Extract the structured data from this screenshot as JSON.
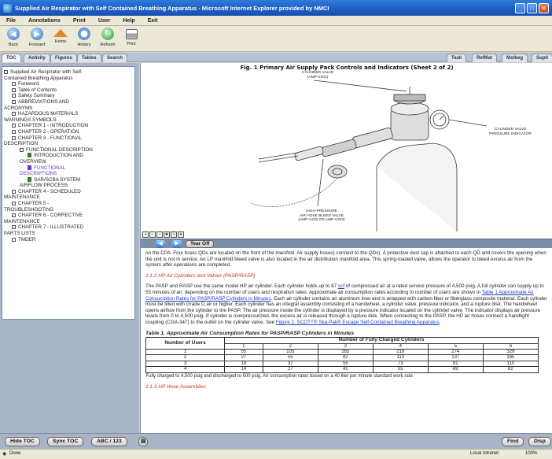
{
  "window": {
    "title": "Supplied Air Respirator with Self Contained Breathing Apparatus - Microsoft Internet Explorer provided by NMCI"
  },
  "menu": [
    "File",
    "Annotations",
    "Print",
    "User",
    "Help",
    "Exit"
  ],
  "toolbar": {
    "back": "Back",
    "forward": "Forward",
    "home": "Home",
    "history": "History",
    "refresh": "Refresh",
    "print": "Print"
  },
  "left_tabs": [
    "TOC",
    "Activity",
    "Figures",
    "Tables",
    "Search"
  ],
  "right_tabs": [
    "Task",
    "RefMat",
    "Mstbeg",
    "Supti"
  ],
  "toc": [
    "Supplied Air Respirator with Self-",
    "Contained Breathing Apparatus",
    "Foreword",
    "Table of Contents",
    "Safety Summary",
    "ABBREVIATIONS AND",
    "ACRONYMS",
    "HAZARDOUS MATERIALS",
    "WARNINGS SYMBOLS",
    "CHAPTER 1 - INTRODUCTION",
    "CHAPTER 2 - OPERATION",
    "CHAPTER 3 - FUNCTIONAL",
    "DESCRIPTION",
    "FUNCTIONAL DESCRIPTION",
    "INTRODUCTION AND",
    "OVERVIEW",
    "FUNCTIONAL",
    "DESCRIPTIONS",
    "SAR/SCBA SYSTEM",
    "AIRFLOW PROCESS",
    "CHAPTER 4 - SCHEDULED",
    "MAINTENANCE",
    "CHAPTER 5 -",
    "TROUBLESHOOTING",
    "CHAPTER 6 - CORRECTIVE",
    "MAINTENANCE",
    "CHAPTER 7 - ILLUSTRATED",
    "PARTS LISTS",
    "TMDER"
  ],
  "figure": {
    "title": "Fig. 1 Primary Air Supply Pack Controls and Indicators (Sheet 2 of 2)",
    "label_valve": "CYLINDER VALVE",
    "label_valve_ref": "(AMP-V201)",
    "label_gauge_1": "CYLINDER VALVE",
    "label_gauge_2": "PRESSURE INDICATOR",
    "label_bleed_1": "HIGH-PRESSURE",
    "label_bleed_2": "AIR HOSE BLEED VALVE",
    "label_bleed_3": "(AMP-V202 OR AMP-V203)"
  },
  "nav": {
    "tear_off": "Tear Off"
  },
  "text": {
    "para0": "on the CPA. Four brass QDs are located on the front of the manifold. Air supply hoses) connect to the QDs). A protective dust cap is attached to each QD and covers the opening when the unit is not in service. An LP manifold bleed valve is also located in the air distribution manifold area. This spring-loaded valve, allows the operator to bleed excess air from the system after operations are completed.",
    "heading1": "1.1.2 HP Air Cylinders and Valves (PASP/RASP)",
    "para1a": "The PASP and RASP use the same model HP air cylinder. Each cylinder holds up to 87 ",
    "scf": "scf",
    "para1b": " of compressed air at a rated service pressure of 4,500 psig. A full cylinder can supply up to 55 minutes of air, depending on the number of users and respiration rates. Approximate air consumption rates according to number of users are shown in ",
    "link1": "Table 1 Approximate Air Consumption Rates for PASP/RASP Cylinders in Minutes",
    "para1c": ". Each air cylinder contains an aluminum liner and is wrapped with carbon fiber or fiberglass composite material. Each cylinder must be filled with Grade D air or higher. Each cylinder has an integral assembly consisting of a handwheel, a cylinder valve, pressure indicator, and a rupture disk. The handwheel opens airflow from the cylinder to the PASP. The air pressure inside the cylinder is displayed by a pressure indicator located on the cylinder valve. The indicator displays air pressure levels from 0 to 4,500 psig. If cylinder is overpressurized, the excess air is released through a rupture disk. When connecting to the PASP, the HP air hoses connect a handtight coupling (CGA-347) to the outlet on the cylinder valve. See ",
    "link2": "Figure 2. SCOTT® Ska-Pak® Escape Self-Contained Breathing Apparatus",
    "para1d": ".",
    "table_title": "Table 1. Approximate Air Consumption Rates for PASP/RASP Cylinders in Minutes",
    "table_col_users": "Number of Users",
    "table_col_cyl": "Number of Fully Charged Cylinders",
    "table_cyl_heads": [
      "1",
      "2",
      "3",
      "4",
      "5",
      "6"
    ],
    "table_rows": [
      [
        "1",
        "55",
        "105",
        "165",
        "219",
        "274",
        "329"
      ],
      [
        "2",
        "27",
        "55",
        "82",
        "110",
        "137",
        "165"
      ],
      [
        "3",
        "18",
        "37",
        "55",
        "73",
        "91",
        "110"
      ],
      [
        "4",
        "14",
        "27",
        "41",
        "55",
        "69",
        "82"
      ]
    ],
    "table_note": "Fully charged to 4,500 psig and discharged to 500 psig. Air consumption rates based on a 40 liter per minute standard work rate.",
    "heading2": "1.1.3 HP Hose Assemblies"
  },
  "bottom": {
    "hide_toc": "Hide TOC",
    "sync_toc": "Sync TOC",
    "abc": "ABC / 123",
    "find": "Find",
    "disp": "Disp"
  },
  "status": {
    "done": "Done",
    "zone": "Local intranet",
    "zoom": "100%"
  }
}
